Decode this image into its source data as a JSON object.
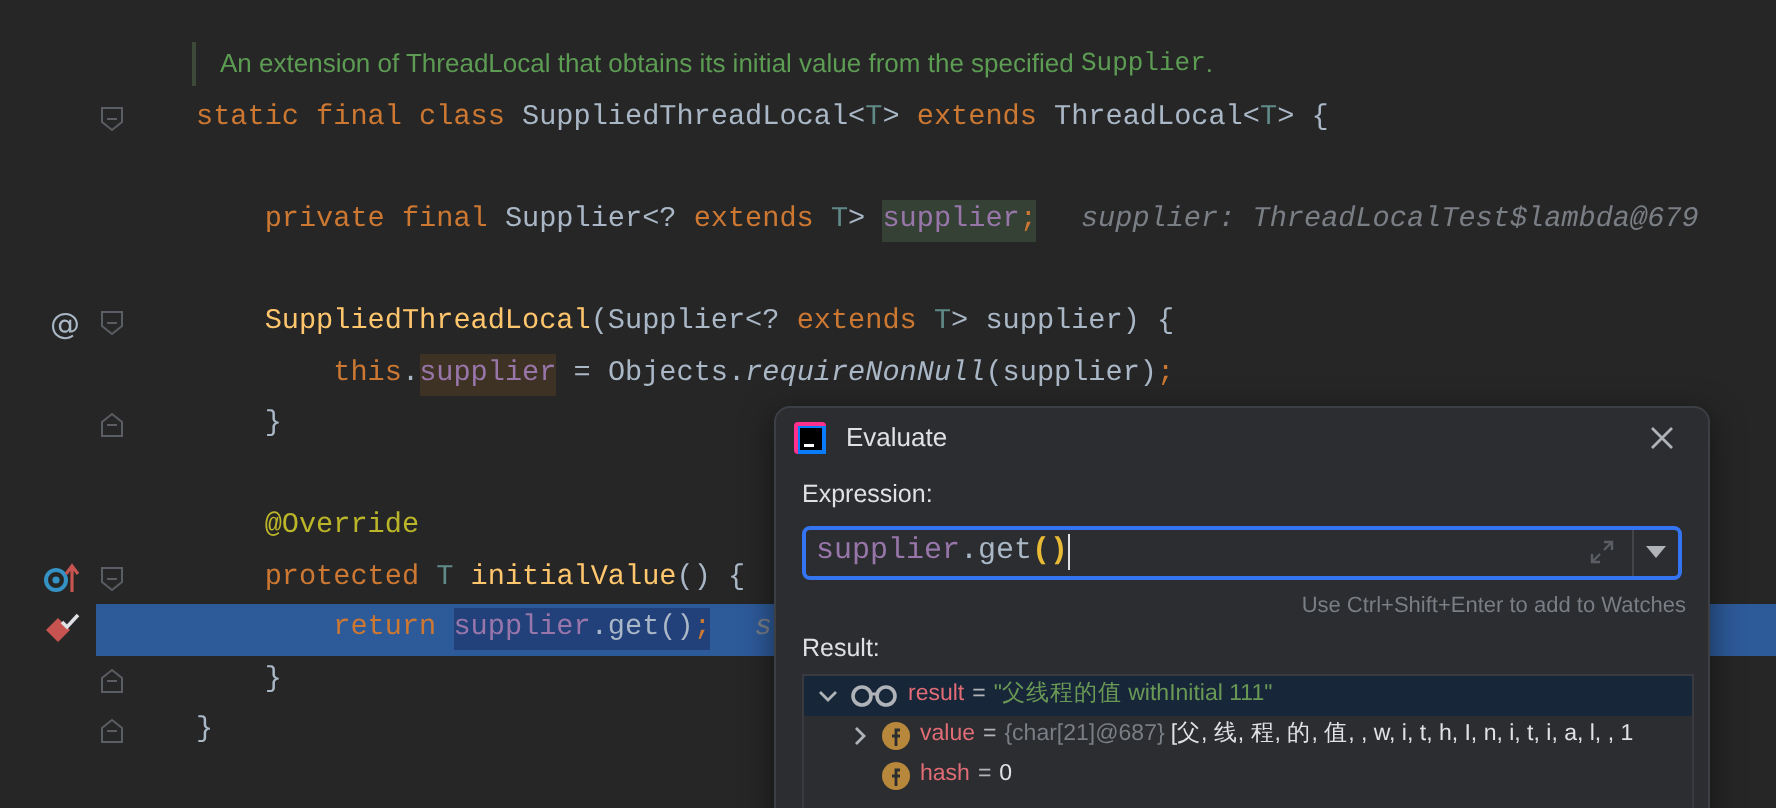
{
  "editor": {
    "lines": [
      {
        "kind": "doc",
        "current": false,
        "tokens": [
          {
            "kind": "doc",
            "text": "An extension of ThreadLocal that obtains its initial value from the specified "
          },
          {
            "kind": "doc-code",
            "text": "Supplier"
          },
          {
            "kind": "doc",
            "text": "."
          }
        ]
      },
      {
        "kind": "code",
        "current": false,
        "gutter": [
          {
            "kind": "fold-start"
          }
        ],
        "tokens": [
          {
            "kind": "kw",
            "text": "static final class "
          },
          {
            "kind": "plain",
            "text": "SuppliedThreadLocal<"
          },
          {
            "kind": "tp",
            "text": "T"
          },
          {
            "kind": "plain",
            "text": "> "
          },
          {
            "kind": "kw",
            "text": "extends "
          },
          {
            "kind": "plain",
            "text": "ThreadLocal<"
          },
          {
            "kind": "tp",
            "text": "T"
          },
          {
            "kind": "plain",
            "text": "> {"
          }
        ]
      },
      {
        "kind": "blank",
        "current": false
      },
      {
        "kind": "code",
        "current": false,
        "tokens": [
          {
            "kind": "kw",
            "text": "    private final "
          },
          {
            "kind": "plain",
            "text": "Supplier<? "
          },
          {
            "kind": "kw",
            "text": "extends "
          },
          {
            "kind": "tp",
            "text": "T"
          },
          {
            "kind": "plain",
            "text": "> "
          },
          {
            "kind": "field-read",
            "text": "supplier"
          },
          {
            "kind": "kw-read",
            "text": ";"
          },
          {
            "kind": "hint",
            "text": "supplier: ThreadLocalTest$lambda@679"
          }
        ]
      },
      {
        "kind": "blank",
        "current": false
      },
      {
        "kind": "code",
        "current": false,
        "gutter": [
          {
            "kind": "text",
            "text": "@"
          },
          {
            "kind": "fold-start"
          }
        ],
        "tokens": [
          {
            "kind": "decl",
            "text": "    SuppliedThreadLocal"
          },
          {
            "kind": "plain",
            "text": "(Supplier<? "
          },
          {
            "kind": "kw",
            "text": "extends "
          },
          {
            "kind": "tp",
            "text": "T"
          },
          {
            "kind": "plain",
            "text": "> supplier) {"
          }
        ]
      },
      {
        "kind": "code",
        "current": false,
        "tokens": [
          {
            "kind": "kw",
            "text": "        this"
          },
          {
            "kind": "plain",
            "text": "."
          },
          {
            "kind": "field-write",
            "text": "supplier"
          },
          {
            "kind": "plain",
            "text": " = Objects."
          },
          {
            "kind": "italic",
            "text": "requireNonNull"
          },
          {
            "kind": "plain",
            "text": "(supplier)"
          },
          {
            "kind": "kw",
            "text": ";"
          }
        ]
      },
      {
        "kind": "code",
        "current": false,
        "gutter": [
          {
            "kind": "fold-end"
          }
        ],
        "tokens": [
          {
            "kind": "plain",
            "text": "    }"
          }
        ]
      },
      {
        "kind": "blank",
        "current": false
      },
      {
        "kind": "code",
        "current": false,
        "tokens": [
          {
            "kind": "ann",
            "text": "    @Override"
          }
        ]
      },
      {
        "kind": "code",
        "current": false,
        "gutter": [
          {
            "kind": "override"
          },
          {
            "kind": "fold-start"
          }
        ],
        "tokens": [
          {
            "kind": "kw",
            "text": "    protected "
          },
          {
            "kind": "tp",
            "text": "T "
          },
          {
            "kind": "decl",
            "text": "initialValue"
          },
          {
            "kind": "plain",
            "text": "() {"
          }
        ]
      },
      {
        "kind": "code",
        "current": true,
        "gutter": [
          {
            "kind": "breakpoint"
          }
        ],
        "tokens": [
          {
            "kind": "kw",
            "text": "        return "
          },
          {
            "kind": "sel-field",
            "text": "supplier"
          },
          {
            "kind": "sel-plain",
            "text": ".get()"
          },
          {
            "kind": "sel-kw",
            "text": ";"
          },
          {
            "kind": "hint",
            "text": "s"
          }
        ]
      },
      {
        "kind": "code",
        "current": false,
        "gutter": [
          {
            "kind": "fold-end"
          }
        ],
        "tokens": [
          {
            "kind": "plain",
            "text": "    }"
          }
        ]
      },
      {
        "kind": "code",
        "current": false,
        "gutter": [
          {
            "kind": "fold-end"
          }
        ],
        "tokens": [
          {
            "kind": "plain",
            "text": "}"
          }
        ]
      }
    ]
  },
  "dialog": {
    "title": "Evaluate",
    "expression_label": "Expression:",
    "expression": [
      {
        "kind": "field",
        "text": "supplier"
      },
      {
        "kind": "plain",
        "text": ".get"
      },
      {
        "kind": "paren",
        "text": "()"
      }
    ],
    "hint": "Use Ctrl+Shift+Enter to add to Watches",
    "result_label": "Result:",
    "tree": [
      {
        "kind": "watch",
        "name": "result",
        "operator": "=",
        "value": "\"父线程的值 withInitial 111\"",
        "selected": true,
        "expanded": true,
        "children": [
          {
            "kind": "field",
            "name": "value",
            "operator": "=",
            "type_info": "{char[21]@687}",
            "value": "[父, 线, 程, 的, 值, , w, i, t, h, I, n, i, t, i, a, l, , 1",
            "selected": false,
            "expanded": false
          },
          {
            "kind": "field",
            "name": "hash",
            "operator": "=",
            "value": "0",
            "selected": false
          }
        ]
      }
    ]
  }
}
